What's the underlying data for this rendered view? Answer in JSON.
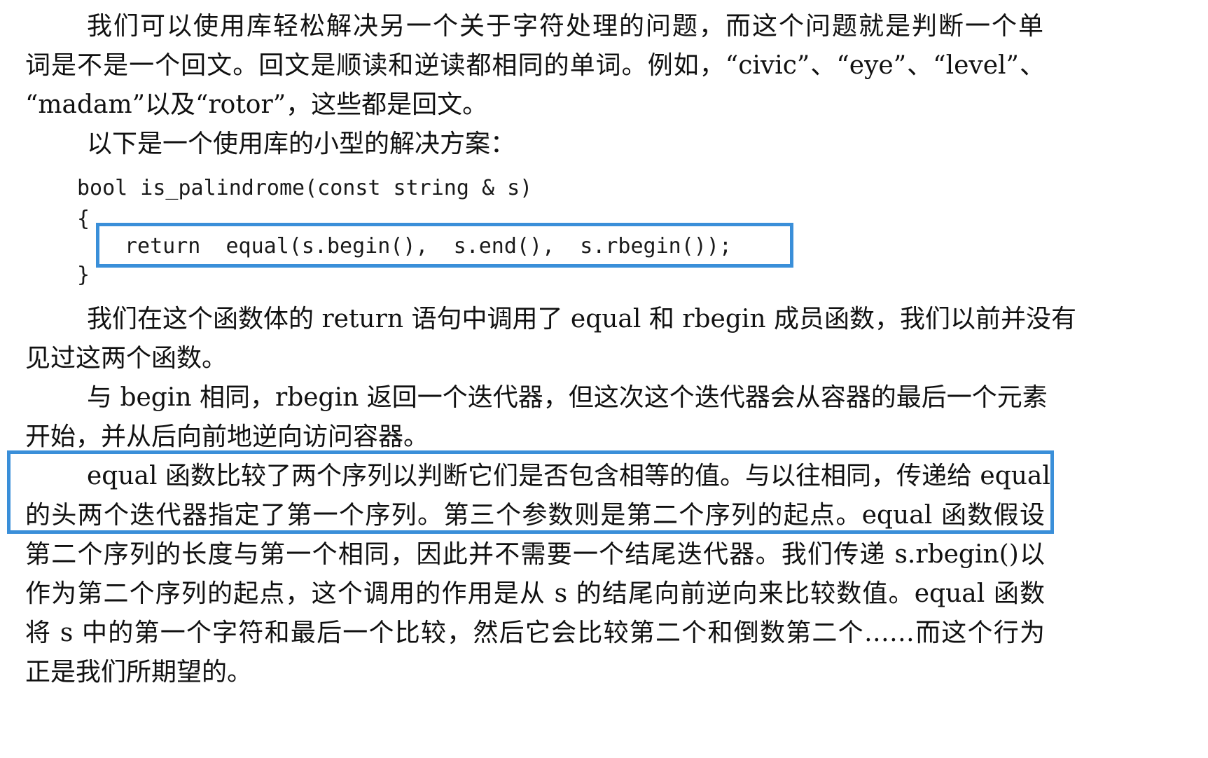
{
  "paragraphs": {
    "p1": [
      "我们可以使用库轻松解决另一个关于字符处理的问题，而这个问题就是判断一个单",
      "词是不是一个回文。回文是顺读和逆读都相同的单词。例如，“civic”、“eye”、“level”、",
      "“madam”以及“rotor”，这些都是回文。"
    ],
    "p2": [
      "以下是一个使用库的小型的解决方案："
    ],
    "code": [
      "bool is_palindrome(const string & s)",
      "{",
      "return  equal(s.begin(),  s.end(),  s.rbegin());",
      "}"
    ],
    "p3": [
      "我们在这个函数体的 return 语句中调用了 equal 和 rbegin 成员函数，我们以前并没有",
      "见过这两个函数。"
    ],
    "p4": [
      "与 begin 相同，rbegin 返回一个迭代器，但这次这个迭代器会从容器的最后一个元素",
      "开始，并从后向前地逆向访问容器。"
    ],
    "p5": [
      "equal 函数比较了两个序列以判断它们是否包含相等的值。与以往相同，传递给 equal",
      "的头两个迭代器指定了第一个序列。第三个参数则是第二个序列的起点。equal 函数假设",
      "第二个序列的长度与第一个相同，因此并不需要一个结尾迭代器。我们传递 s.rbegin()以",
      "作为第二个序列的起点，这个调用的作用是从 s 的结尾向前逆向来比较数值。equal 函数",
      "将 s 中的第一个字符和最后一个比较，然后它会比较第二个和倒数第二个……而这个行为",
      "正是我们所期望的。"
    ]
  },
  "highlight_color": "#3a8fd9"
}
